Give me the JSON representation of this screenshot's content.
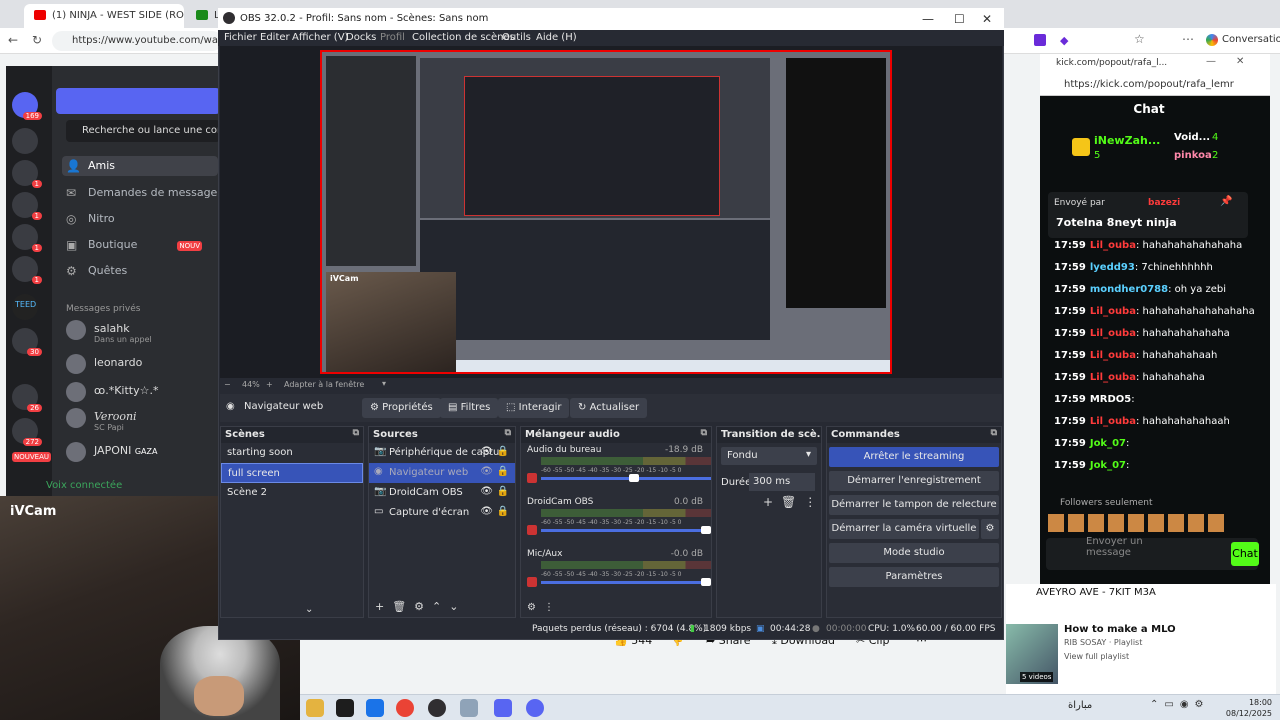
{
  "browser": {
    "tabs": [
      {
        "label": "(1) NINJA - WEST SIDE (ROLEPLAY",
        "active": true
      },
      {
        "label": "La",
        "active": false
      }
    ],
    "url": "https://www.youtube.com/watch?v="
  },
  "discord": {
    "search_placeholder": "Recherche ou lance une conversat",
    "nav": [
      {
        "label": "Amis",
        "icon": "friends-icon"
      },
      {
        "label": "Demandes de message",
        "icon": "mail-icon"
      },
      {
        "label": "Nitro",
        "icon": "nitro-icon"
      },
      {
        "label": "Boutique",
        "icon": "shop-icon",
        "badge": "NOUV"
      },
      {
        "label": "Quêtes",
        "icon": "quests-icon"
      }
    ],
    "dm_header": "Messages privés",
    "dms": [
      {
        "name": "salahk",
        "sub": "Dans un appel"
      },
      {
        "name": "leonardo",
        "sub": ""
      },
      {
        "name": "ꝏ.*Kitty☆.*",
        "sub": ""
      },
      {
        "name": "Verooni",
        "sub": "SC Papi"
      },
      {
        "name": "JAPONI",
        "sub": "GAZA"
      }
    ],
    "server_badges": [
      "169",
      "1",
      "1",
      "1",
      "1",
      "30",
      "26",
      "272"
    ],
    "voice_status": "Voix connectée",
    "nouveau_label": "NOUVEAU"
  },
  "ivcam": {
    "title": "iVCam"
  },
  "obs": {
    "title": "OBS 32.0.2 - Profil: Sans nom - Scènes: Sans nom",
    "menu": [
      "Fichier",
      "Editer",
      "Afficher (V)",
      "Docks",
      "Profil",
      "Collection de scènes",
      "Outils",
      "Aide (H)"
    ],
    "zoom": "44%",
    "zoom_mode": "Adapter à la fenêtre",
    "preview_cam_label": "iVCam",
    "selected_source_label": "Navigateur web",
    "source_buttons": [
      "Propriétés",
      "Filtres",
      "Interagir",
      "Actualiser"
    ],
    "docks": {
      "scenes": "Scènes",
      "sources": "Sources",
      "mixer": "Mélangeur audio",
      "transitions": "Transition de scè...",
      "commands": "Commandes"
    },
    "scenes": [
      {
        "name": "starting soon",
        "selected": false
      },
      {
        "name": "full screen",
        "selected": true
      },
      {
        "name": "Scène 2",
        "selected": false
      }
    ],
    "sources": [
      {
        "name": "Périphérique de captu",
        "icon": "camera-icon",
        "selected": false
      },
      {
        "name": "Navigateur web",
        "icon": "globe-icon",
        "selected": true
      },
      {
        "name": "DroidCam OBS",
        "icon": "camera-icon",
        "selected": false
      },
      {
        "name": "Capture d'écran",
        "icon": "monitor-icon",
        "selected": false
      }
    ],
    "mixer": [
      {
        "name": "Audio du bureau",
        "db": "-18.9 dB",
        "level": 0.55
      },
      {
        "name": "DroidCam OBS",
        "db": "0.0 dB",
        "level": 1.0
      },
      {
        "name": "Mic/Aux",
        "db": "-0.0 dB",
        "level": 1.0
      }
    ],
    "mixer_ticks": "-60 -55 -50 -45 -40 -35 -30 -25 -20 -15 -10 -5 0",
    "transition": {
      "type": "Fondu",
      "duration_label": "Durée",
      "duration": "300 ms"
    },
    "commands": [
      {
        "label": "Arrêter le streaming",
        "primary": true
      },
      {
        "label": "Démarrer l'enregistrement",
        "primary": false
      },
      {
        "label": "Démarrer le tampon de relecture",
        "primary": false
      },
      {
        "label": "Démarrer la caméra virtuelle",
        "primary": false
      },
      {
        "label": "Mode studio",
        "primary": false
      },
      {
        "label": "Paramètres",
        "primary": false
      }
    ],
    "status": {
      "dropped": "Paquets perdus (réseau) : 6704 (4.8%)",
      "bitrate": "1809 kbps",
      "stream_time": "00:44:28",
      "rec_time": "00:00:00",
      "cpu": "CPU: 1.0%",
      "fps": "60.00 / 60.00 FPS"
    }
  },
  "kick": {
    "url": "https://kick.com/popout/rafa_lemr",
    "short_url": "kick.com/popout/rafa_l...",
    "chat_title": "Chat",
    "gifters": [
      {
        "name": "iNewZah...",
        "count": "5"
      },
      {
        "name": "Void...",
        "count": "4"
      },
      {
        "name": "pinkoa",
        "count": "2"
      }
    ],
    "pinned_by_label": "Envoyé par",
    "pinned_by": "bazezi",
    "pinned_text": "7otelna 8neyt ninja",
    "messages": [
      {
        "time": "17:59",
        "user": "Lil_ouba",
        "text": "hahahahahahahaha",
        "color": "#ff3b3b"
      },
      {
        "time": "17:59",
        "user": "lyedd93",
        "text": "7chinehhhhhh",
        "color": "#5bd0ff"
      },
      {
        "time": "17:59",
        "user": "mondher0788",
        "text": "oh ya zebi",
        "color": "#5bd0ff"
      },
      {
        "time": "17:59",
        "user": "Lil_ouba",
        "text": "hahahahahahahahaha",
        "color": "#ff3b3b"
      },
      {
        "time": "17:59",
        "user": "Lil_ouba",
        "text": "hahahahahahaha",
        "color": "#ff3b3b"
      },
      {
        "time": "17:59",
        "user": "Lil_ouba",
        "text": "hahahahahaah",
        "color": "#ff3b3b"
      },
      {
        "time": "17:59",
        "user": "Lil_ouba",
        "text": "hahahahaha",
        "color": "#ff3b3b"
      },
      {
        "time": "17:59",
        "user": "MRDO5",
        "text": "",
        "color": "#ffffff"
      },
      {
        "time": "17:59",
        "user": "Lil_ouba",
        "text": "hahahahahahaah",
        "color": "#ff3b3b"
      },
      {
        "time": "17:59",
        "user": "Jok_07",
        "text": "",
        "color": "#53fc18"
      },
      {
        "time": "17:59",
        "user": "Jok_07",
        "text": "",
        "color": "#53fc18"
      }
    ],
    "followers_only": "Followers seulement",
    "input_placeholder": "Envoyer un message",
    "send_label": "Chat"
  },
  "youtube": {
    "likes": "544",
    "share": "Share",
    "download": "Download",
    "clip": "Clip",
    "playlist_header": "AVEYRO AVE - 7KIT M3A",
    "video_title": "How to make a MLO",
    "video_channel": "RIB SOSAY · Playlist",
    "video_playlist": "View full playlist",
    "video_count": "5 videos"
  },
  "taskbar": {
    "weather_text": "مباراة",
    "time": "18:00",
    "date": "08/12/2025"
  }
}
